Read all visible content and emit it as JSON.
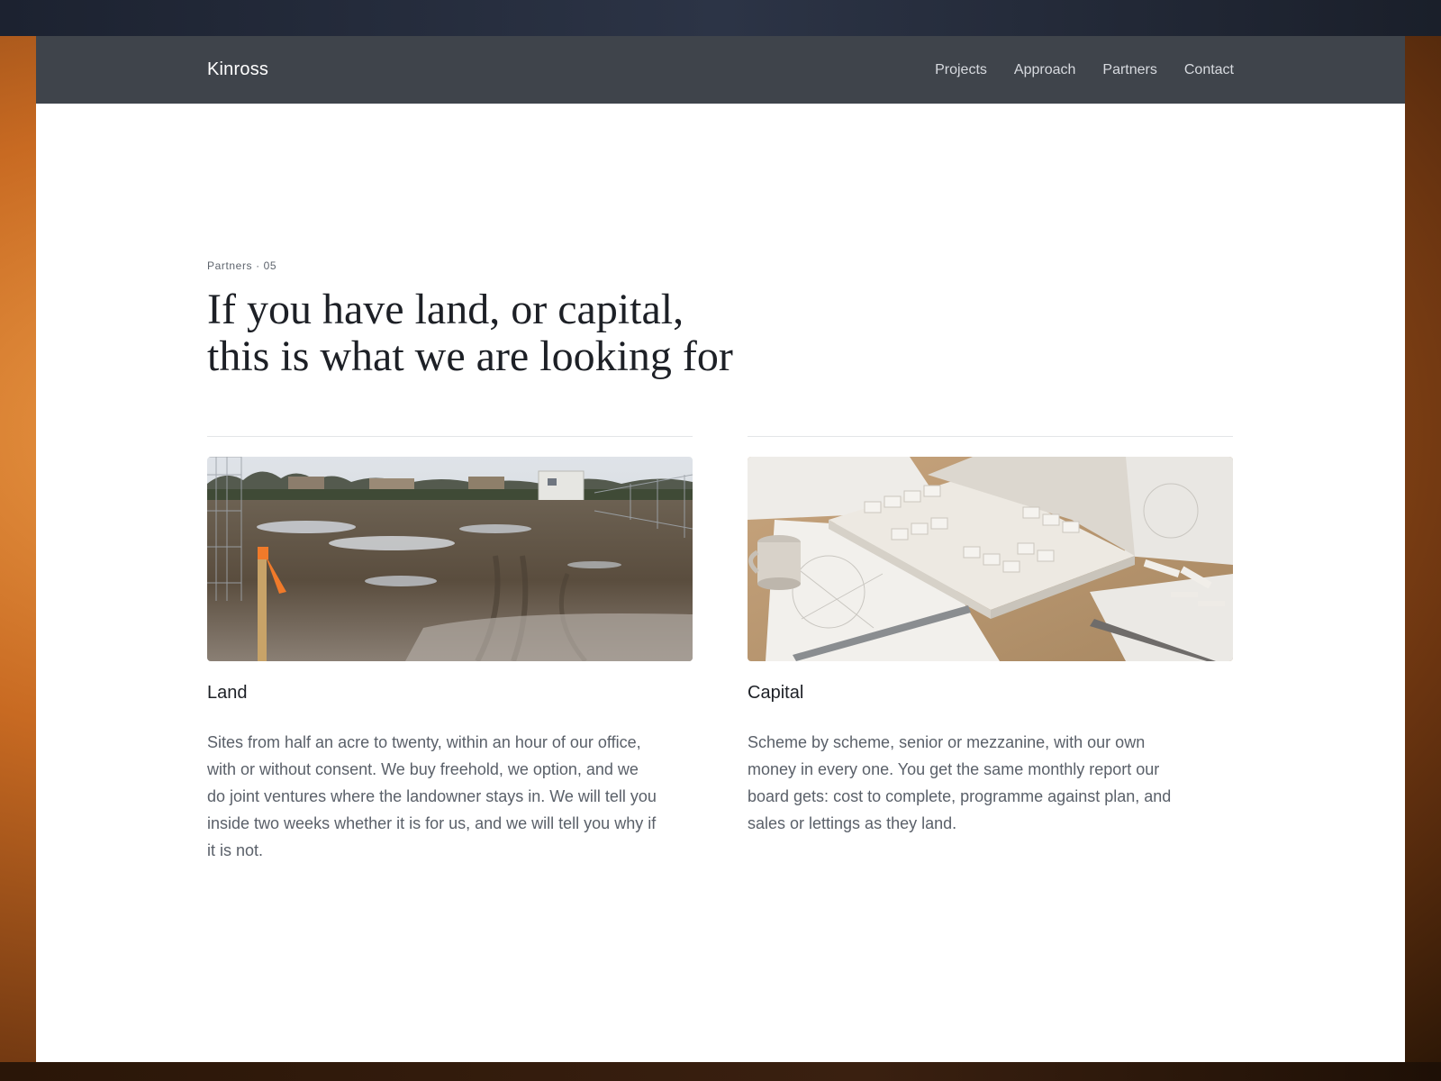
{
  "header": {
    "brand": "Kinross",
    "nav": [
      "Projects",
      "Approach",
      "Partners",
      "Contact"
    ]
  },
  "hero": {
    "eyebrow": "Partners · 05",
    "headline_line1": "If you have land, or capital,",
    "headline_line2": "this is what we are looking for"
  },
  "cards": [
    {
      "title": "Land",
      "image_icon": "muddy-site-photo",
      "body": "Sites from half an acre to twenty, within an hour of our office, with or without consent. We buy freehold, we option, and we do joint ventures where the landowner stays in. We will tell you inside two weeks whether it is for us, and we will tell you why if it is not."
    },
    {
      "title": "Capital",
      "image_icon": "architectural-model-photo",
      "body": "Scheme by scheme, senior or mezzanine, with our own money in every one. You get the same monthly report our board gets: cost to complete, programme against plan, and sales or lettings as they land."
    }
  ],
  "colors": {
    "topbar": "#3f444b",
    "heading": "#1d2026",
    "body_text": "#5a6069",
    "rule": "#e3e5e8"
  }
}
